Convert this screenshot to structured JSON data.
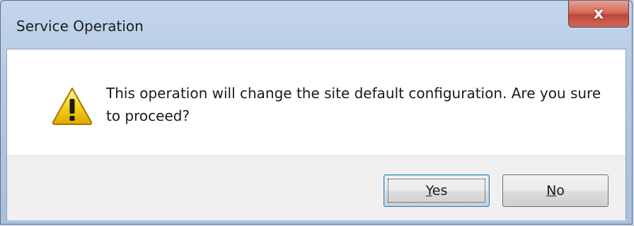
{
  "dialog": {
    "title": "Service Operation",
    "close_label": "x",
    "message": "This operation will change the site default configuration. Are you sure to proceed?",
    "icon": "warning-icon",
    "buttons": {
      "yes": {
        "mnemonic": "Y",
        "rest": "es"
      },
      "no": {
        "mnemonic": "N",
        "rest": "o"
      }
    },
    "default_button": "yes"
  },
  "colors": {
    "titlebar": "#b3c8e2",
    "close_button": "#c0463a",
    "content_bg": "#ffffff",
    "button_area_bg": "#f0f0f0",
    "warning_yellow": "#f5c400"
  }
}
